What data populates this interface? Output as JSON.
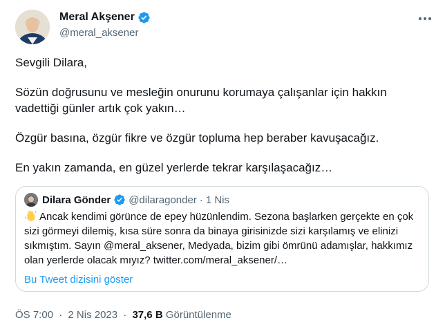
{
  "author": {
    "display_name": "Meral Akşener",
    "handle": "@meral_aksener",
    "verified_icon": "verified-badge-icon",
    "avatar_icon": "profile-avatar"
  },
  "tweet": {
    "paragraphs": [
      "Sevgili Dilara,",
      "Sözün doğrusunu ve mesleğin onurunu korumaya çalışanlar için hakkın vadettiği günler artık çok yakın…",
      "Özgür basına, özgür fikre ve özgür topluma hep beraber kavuşacağız.",
      "En yakın zamanda, en güzel yerlerde tekrar karşılaşacağız…"
    ]
  },
  "quote": {
    "display_name": "Dilara Gönder",
    "handle": "@dilaragonder",
    "separator": "·",
    "date": "1 Nis",
    "emoji": "waving-hand-icon",
    "body": "Ancak kendimi görünce de epey hüzünlendim. Sezona başlarken gerçekte en çok sizi görmeyi dilemiş, kısa süre sonra da binaya girisinizde sizi karşılamış ve elinizi sıkmıştım. Sayın @meral_aksener, Medyada, bizim gibi ömrünü adamışlar, hakkımız olan yerlerde olacak mıyız? twitter.com/meral_aksener/…",
    "show_thread": "Bu Tweet dizisini göster"
  },
  "meta": {
    "time": "ÖS 7:00",
    "separator": "·",
    "date": "2 Nis 2023",
    "views_count": "37,6 B",
    "views_label": "Görüntülenme"
  },
  "colors": {
    "text_primary": "#0f1419",
    "text_secondary": "#536471",
    "accent": "#1d9bf0",
    "border": "#cfd9de"
  }
}
